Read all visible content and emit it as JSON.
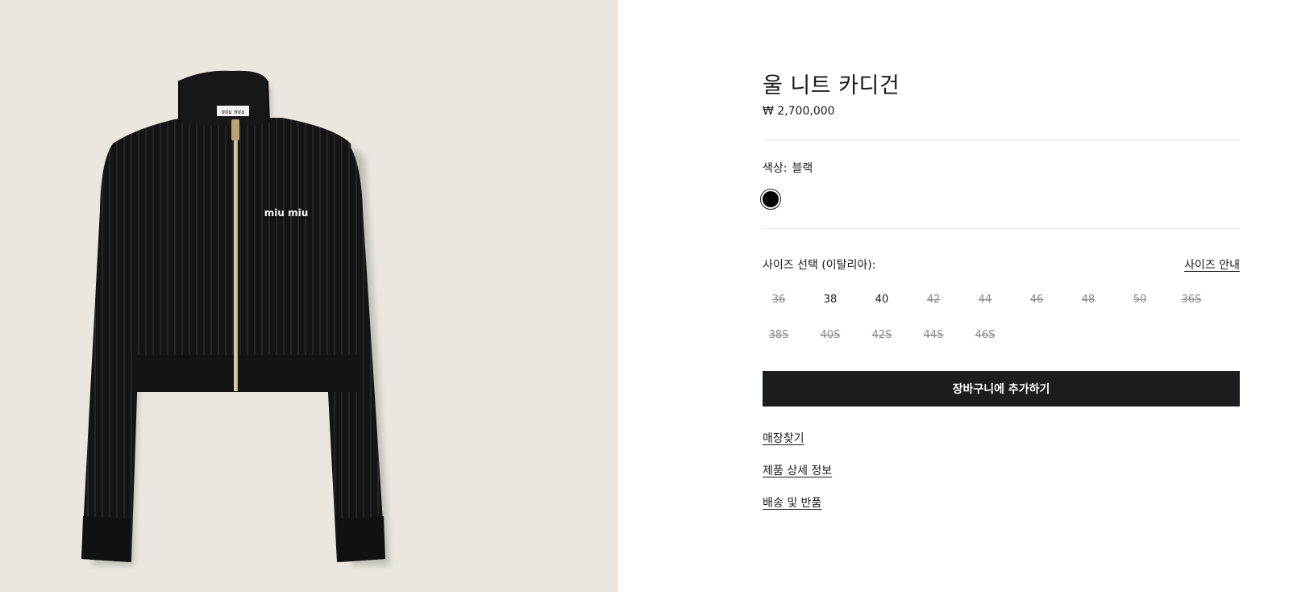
{
  "product": {
    "title": "울 니트 카디건",
    "price": "₩ 2,700,000",
    "image_logo_text": "miu miu"
  },
  "color": {
    "label": "색상:",
    "value": "블랙",
    "swatches": [
      {
        "name": "블랙",
        "hex": "#000000",
        "selected": true
      }
    ]
  },
  "size": {
    "label": "사이즈 선택 (이탈리아):",
    "guide_link": "사이즈 안내",
    "options": [
      {
        "label": "36",
        "available": false
      },
      {
        "label": "38",
        "available": true
      },
      {
        "label": "40",
        "available": true
      },
      {
        "label": "42",
        "available": false
      },
      {
        "label": "44",
        "available": false
      },
      {
        "label": "46",
        "available": false
      },
      {
        "label": "48",
        "available": false
      },
      {
        "label": "50",
        "available": false
      },
      {
        "label": "36S",
        "available": false
      },
      {
        "label": "38S",
        "available": false
      },
      {
        "label": "40S",
        "available": false
      },
      {
        "label": "42S",
        "available": false
      },
      {
        "label": "44S",
        "available": false
      },
      {
        "label": "46S",
        "available": false
      }
    ]
  },
  "actions": {
    "add_to_cart": "장바구니에 추가하기"
  },
  "links": {
    "store_finder": "매장찾기",
    "product_details": "제품 상세 정보",
    "shipping_returns": "배송 및 반품"
  },
  "colors": {
    "image_background": "#ebe7e0",
    "button_background": "#1b1d1f",
    "unavailable_text": "#8a8a8a"
  }
}
